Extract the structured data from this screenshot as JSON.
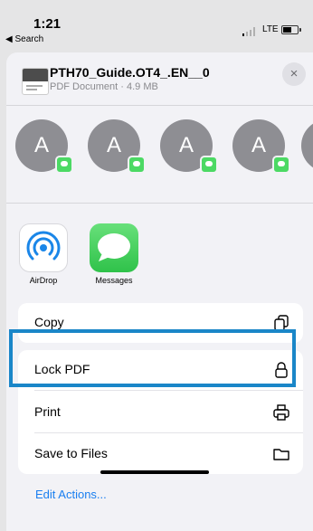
{
  "status_bar": {
    "time": "1:21",
    "back_label": "◀ Search",
    "network": "LTE"
  },
  "document": {
    "title": "PTH70_Guide.OT4_.EN__0",
    "subtitle": "PDF Document · 4.9 MB",
    "close_icon": "×"
  },
  "contacts": [
    {
      "initial": "A"
    },
    {
      "initial": "A"
    },
    {
      "initial": "A"
    },
    {
      "initial": "A"
    }
  ],
  "apps": [
    {
      "label": "AirDrop",
      "icon": "airdrop-icon"
    },
    {
      "label": "Messages",
      "icon": "messages-icon"
    }
  ],
  "actions": [
    {
      "label": "Copy",
      "icon": "copy-icon"
    },
    {
      "label": "Lock PDF",
      "icon": "lock-icon"
    },
    {
      "label": "Print",
      "icon": "printer-icon"
    },
    {
      "label": "Save to Files",
      "icon": "folder-icon"
    }
  ],
  "edit_actions_label": "Edit Actions...",
  "colors": {
    "highlight": "#1a86c8",
    "link": "#1a7ff0",
    "messages_green": "#4cd964"
  }
}
